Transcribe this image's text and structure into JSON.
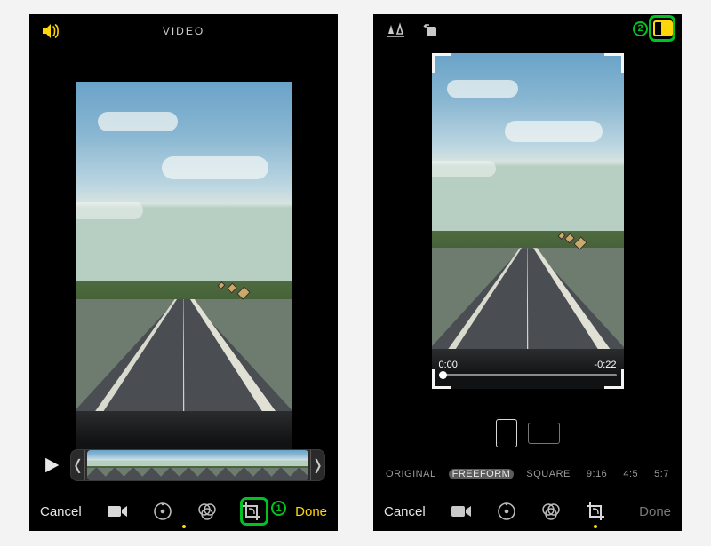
{
  "colors": {
    "accent": "#ffd60a",
    "annotation": "#00c322"
  },
  "screen1": {
    "title": "VIDEO",
    "cancel_label": "Cancel",
    "done_label": "Done",
    "annotation": "1",
    "tools": [
      "video",
      "adjust",
      "filters",
      "crop"
    ]
  },
  "screen2": {
    "cancel_label": "Cancel",
    "done_label": "Done",
    "annotation": "2",
    "time": {
      "current": "0:00",
      "remaining": "-0:22"
    },
    "aspect_options": [
      "ORIGINAL",
      "FREEFORM",
      "SQUARE",
      "9:16",
      "4:5",
      "5:7"
    ],
    "aspect_selected": "FREEFORM",
    "tools": [
      "video",
      "adjust",
      "filters",
      "crop"
    ]
  }
}
